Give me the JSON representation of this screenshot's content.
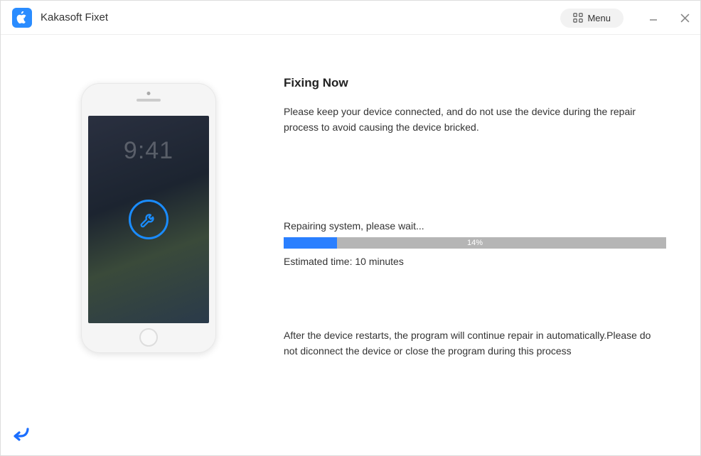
{
  "app": {
    "title": "Kakasoft Fixet",
    "menu_label": "Menu"
  },
  "main": {
    "heading": "Fixing Now",
    "subtext": "Please keep your device connected, and do not use the device during the repair process to avoid causing the device bricked.",
    "status_text": "Repairing system, please wait...",
    "progress_percent": "14%",
    "progress_width": "width:14%",
    "estimated_label": "Estimated time: 10 minutes",
    "footer_note": "After the device restarts, the program will continue repair in automatically.Please do not diconnect the device or close the program during this process"
  },
  "phone": {
    "time": "9:41"
  }
}
